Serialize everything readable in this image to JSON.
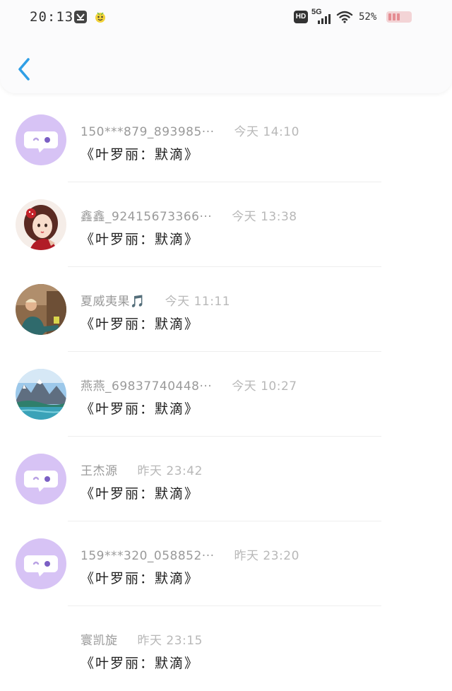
{
  "status_bar": {
    "time": "20:13",
    "network": "5G",
    "hd": "HD",
    "battery": "52%"
  },
  "header": {
    "back_icon": "chevron-left-icon"
  },
  "conversations": [
    {
      "name": "150***879_893985···",
      "time": "今天 14:10",
      "message": "《叶罗丽：默滴》",
      "avatar": "default"
    },
    {
      "name": "鑫鑫_92415673366···",
      "time": "今天 13:38",
      "message": "《叶罗丽：默滴》",
      "avatar": "girl-cartoon"
    },
    {
      "name": "夏威夷果🎵",
      "time": "今天 11:11",
      "message": "《叶罗丽：默滴》",
      "avatar": "photo-person"
    },
    {
      "name": "燕燕_69837740448···",
      "time": "今天 10:27",
      "message": "《叶罗丽：默滴》",
      "avatar": "mountain-lake"
    },
    {
      "name": "王杰源",
      "time": "昨天 23:42",
      "message": "《叶罗丽：默滴》",
      "avatar": "default"
    },
    {
      "name": "159***320_058852···",
      "time": "昨天 23:20",
      "message": "《叶罗丽：默滴》",
      "avatar": "default"
    },
    {
      "name": "寰凯旋",
      "time": "昨天 23:15",
      "message": "《叶罗丽：默滴》",
      "avatar": "none"
    }
  ],
  "colors": {
    "accent": "#2f9fe6",
    "default_avatar": "#d7c3f5",
    "separator": "#eeeeee"
  }
}
